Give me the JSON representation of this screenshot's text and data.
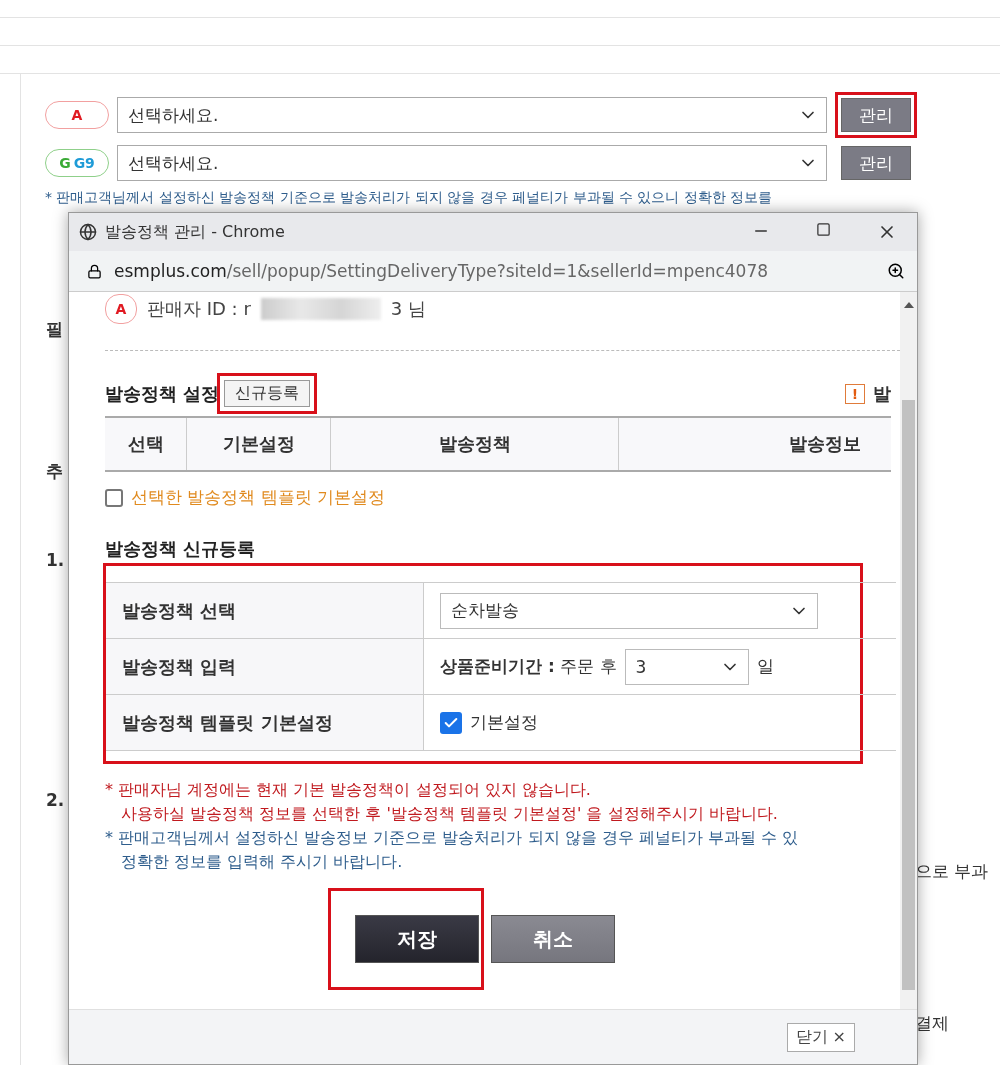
{
  "page": {
    "sites": [
      {
        "kind": "auction",
        "logo": [
          "A"
        ],
        "select": "선택하세요.",
        "button": "관리",
        "highlighted": true
      },
      {
        "kind": "gmarket",
        "logo": [
          "G",
          "G9"
        ],
        "select": "선택하세요.",
        "button": "관리",
        "highlighted": false
      }
    ],
    "notice": "* 판매고객님께서 설정하신 발송정책 기준으로 발송처리가 되지 않을 경우 페널티가 부과될 수 있으니 정확한 정보를",
    "left_fragments": [
      "필",
      "추",
      "1.",
      "2."
    ],
    "right_fragments": [
      "으로 부과",
      "결제"
    ]
  },
  "popup": {
    "title": "발송정책 관리 - Chrome",
    "url_host": "esmplus.com",
    "url_path": "/sell/popup/SettingDeliveryType?siteId=1&sellerId=mpenc4078",
    "seller": {
      "logo": "A",
      "label": "판매자 ID : r",
      "suffix": "3 님"
    },
    "settings": {
      "title": "발송정책 설정",
      "new_button": "신규등록",
      "new_button_highlighted": true,
      "help_icon": "!",
      "help": "발",
      "columns": [
        "선택",
        "기본설정",
        "발송정책",
        "발송정보"
      ],
      "default_checkbox": {
        "label": "선택한 발송정책 템플릿 기본설정",
        "checked": false
      }
    },
    "register": {
      "title": "발송정책 신규등록",
      "highlighted": true,
      "rows": [
        {
          "kind": "select",
          "label": "발송정책 선택",
          "value": "순차발송"
        },
        {
          "kind": "period",
          "label": "발송정책 입력",
          "field_label": "상품준비기간 :",
          "prefix": "주문 후",
          "value": "3",
          "unit": "일"
        },
        {
          "kind": "checkbox",
          "label": "발송정책 템플릿 기본설정",
          "option": "기본설정",
          "checked": true
        }
      ]
    },
    "warnings": [
      {
        "kind": "red",
        "lines": [
          "* 판매자님 계정에는 현재 기본 발송정책이 설정되어 있지 않습니다.",
          "사용하실 발송정책 정보를 선택한 후 '발송정책 템플릿 기본설정' 을 설정해주시기 바랍니다."
        ]
      },
      {
        "kind": "blue",
        "lines": [
          "* 판매고객님께서 설정하신 발송정보 기준으로 발송처리가 되지 않을 경우 페널티가 부과될 수 있",
          "정확한 정보를 입력해 주시기 바랍니다."
        ]
      }
    ],
    "buttons": [
      {
        "kind": "primary",
        "label": "저장",
        "highlighted": true
      },
      {
        "kind": "secondary",
        "label": "취소",
        "highlighted": false
      }
    ],
    "close_button": "닫기 ×"
  }
}
